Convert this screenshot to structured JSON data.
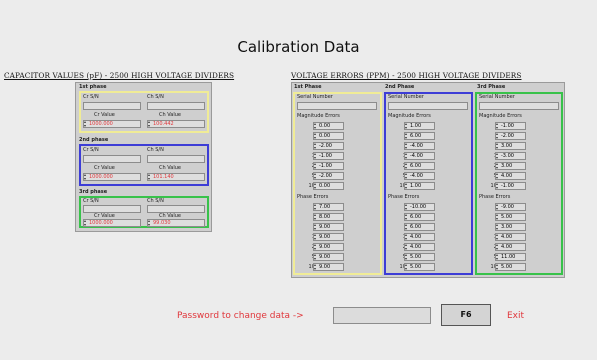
{
  "title": "Calibration Data",
  "capacitor": {
    "header": "CAPACITOR VALUES (pF) - 2500 HIGH VOLTAGE DIVIDERS",
    "cr_sn_label": "Cr S/N",
    "ch_sn_label": "Ch S/N",
    "cr_value_label": "Cr Value",
    "ch_value_label": "Ch Value",
    "phases": [
      {
        "name": "1st phase",
        "cr_value": "1000.000",
        "ch_value": "100.442"
      },
      {
        "name": "2nd phase",
        "cr_value": "1000.000",
        "ch_value": "101.140"
      },
      {
        "name": "3rd phase",
        "cr_value": "1000.000",
        "ch_value": "99.030"
      }
    ]
  },
  "voltage": {
    "header": "VOLTAGE ERRORS (PPM) - 2500 HIGH VOLTAGE DIVIDERS",
    "serial_label": "Serial Number",
    "mag_label": "Magnitude Errors",
    "phase_label": "Phase Errors",
    "phases": [
      {
        "name": "1st Phase",
        "magnitude": [
          {
            "kv": "1 kV",
            "value": "0.00"
          },
          {
            "kv": "2 kV",
            "value": "0.00"
          },
          {
            "kv": "5 kV",
            "value": "-2.00"
          },
          {
            "kv": "10 kV",
            "value": "-1.00"
          },
          {
            "kv": "20 kV",
            "value": "-1.00"
          },
          {
            "kv": "50 kV",
            "value": "-2.00"
          },
          {
            "kv": "100 kV",
            "value": "0.00"
          }
        ],
        "phase": [
          {
            "kv": "1 kV",
            "value": "7.00"
          },
          {
            "kv": "2 kV",
            "value": "8.00"
          },
          {
            "kv": "5 kV",
            "value": "9.00"
          },
          {
            "kv": "10 kV",
            "value": "9.00"
          },
          {
            "kv": "20 kV",
            "value": "9.00"
          },
          {
            "kv": "50 kV",
            "value": "9.00"
          },
          {
            "kv": "100 kV",
            "value": "9.00"
          }
        ]
      },
      {
        "name": "2nd Phase",
        "magnitude": [
          {
            "kv": "1 kV",
            "value": "1.00"
          },
          {
            "kv": "2 kV",
            "value": "6.00"
          },
          {
            "kv": "5 kV",
            "value": "-4.00"
          },
          {
            "kv": "10 kV",
            "value": "-4.00"
          },
          {
            "kv": "20 kV",
            "value": "6.00"
          },
          {
            "kv": "50 kV",
            "value": "-4.00"
          },
          {
            "kv": "100 kV",
            "value": "1.00"
          }
        ],
        "phase": [
          {
            "kv": "1 kV",
            "value": "-10.00"
          },
          {
            "kv": "2 kV",
            "value": "6.00"
          },
          {
            "kv": "5 kV",
            "value": "6.00"
          },
          {
            "kv": "10 kV",
            "value": "4.00"
          },
          {
            "kv": "20 kV",
            "value": "4.00"
          },
          {
            "kv": "50 kV",
            "value": "5.00"
          },
          {
            "kv": "100 kV",
            "value": "5.00"
          }
        ]
      },
      {
        "name": "3rd Phase",
        "magnitude": [
          {
            "kv": "1 kV",
            "value": "-1.00"
          },
          {
            "kv": "2 kV",
            "value": "-2.00"
          },
          {
            "kv": "5 kV",
            "value": "3.00"
          },
          {
            "kv": "10 kV",
            "value": "-3.00"
          },
          {
            "kv": "20 kV",
            "value": "3.00"
          },
          {
            "kv": "50 kV",
            "value": "4.00"
          },
          {
            "kv": "100 kV",
            "value": "-1.00"
          }
        ],
        "phase": [
          {
            "kv": "1 kV",
            "value": "-9.00"
          },
          {
            "kv": "2 kV",
            "value": "5.00"
          },
          {
            "kv": "5 kV",
            "value": "3.00"
          },
          {
            "kv": "10 kV",
            "value": "4.00"
          },
          {
            "kv": "20 kV",
            "value": "4.00"
          },
          {
            "kv": "50 kV",
            "value": "11.00"
          },
          {
            "kv": "100 kV",
            "value": "5.00"
          }
        ]
      }
    ]
  },
  "footer": {
    "password_label": "Password to change data ->",
    "password_value": "",
    "f6_label": "F6",
    "exit_label": "Exit"
  },
  "colors": {
    "accent_red": "#e0373c",
    "phase1": "#f0ec96",
    "phase2": "#3d3dd6",
    "phase3": "#38c24a"
  }
}
